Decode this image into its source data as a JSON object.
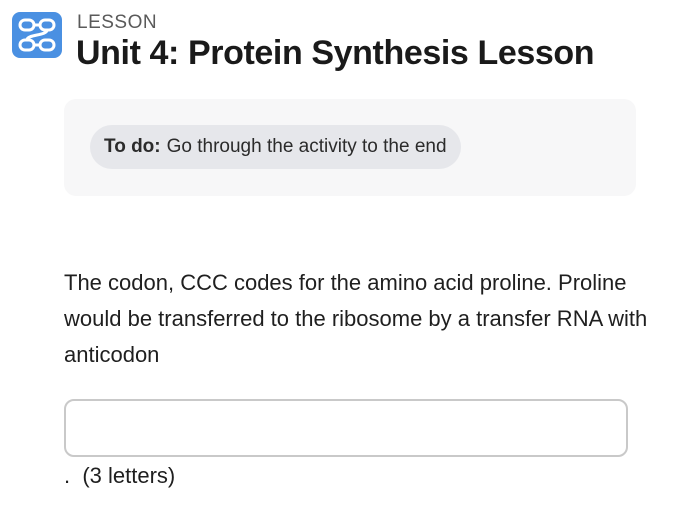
{
  "header": {
    "icon": "workflow-icon",
    "eyebrow": "LESSON",
    "title": "Unit 4: Protein Synthesis Lesson",
    "accent_color": "#4a90e2"
  },
  "todo": {
    "label": "To do:",
    "text": "Go through the activity to the end"
  },
  "question": {
    "prompt": "The codon, CCC codes for the amino acid proline. Proline would be transferred to the ribosome by a transfer RNA with anticodon",
    "answer_value": "",
    "after_blank": ".  (3 letters)"
  }
}
